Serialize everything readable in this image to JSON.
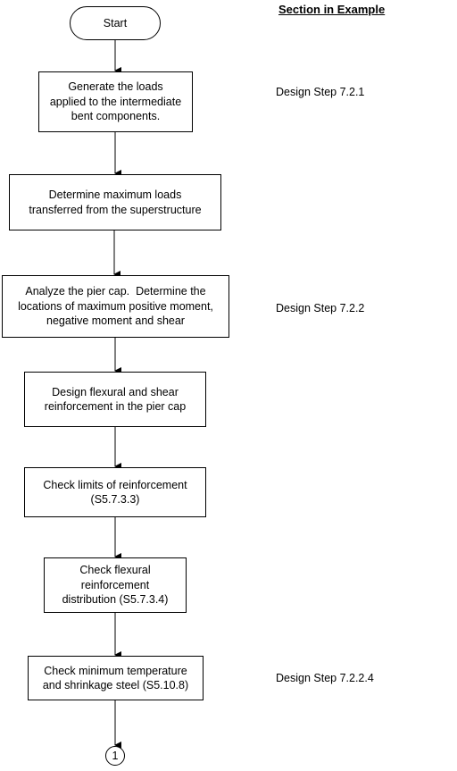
{
  "header": {
    "title": "Section in Example"
  },
  "flowchart": {
    "start": {
      "label": "Start"
    },
    "steps": [
      {
        "label": "Generate the loads applied to the intermediate bent components.",
        "lines": [
          "Generate the loads",
          "applied to the intermediate",
          "bent components."
        ],
        "section": "Design Step 7.2.1"
      },
      {
        "label": "Determine maximum loads transferred from the superstructure",
        "lines": [
          "Determine maximum loads",
          "transferred from the superstructure"
        ],
        "section": ""
      },
      {
        "label": "Analyze the pier cap. Determine the locations of maximum positive moment, negative moment and shear",
        "lines": [
          "Analyze the pier cap.  Determine the",
          "locations of maximum positive moment,",
          "negative moment and shear"
        ],
        "section": "Design Step 7.2.2"
      },
      {
        "label": "Design flexural and shear reinforcement in the pier cap",
        "lines": [
          "Design flexural and shear",
          "reinforcement in the pier cap"
        ],
        "section": ""
      },
      {
        "label": "Check limits of reinforcement (S5.7.3.3)",
        "lines": [
          "Check limits of reinforcement",
          "(S5.7.3.3)"
        ],
        "section": ""
      },
      {
        "label": "Check flexural reinforcement distribution (S5.7.3.4)",
        "lines": [
          "Check flexural",
          "reinforcement",
          "distribution (S5.7.3.4)"
        ],
        "section": ""
      },
      {
        "label": "Check minimum temperature and shrinkage steel (S5.10.8)",
        "lines": [
          "Check minimum temperature",
          "and shrinkage steel (S5.10.8)"
        ],
        "section": "Design Step 7.2.2.4"
      }
    ],
    "connector": {
      "label": "1"
    }
  }
}
